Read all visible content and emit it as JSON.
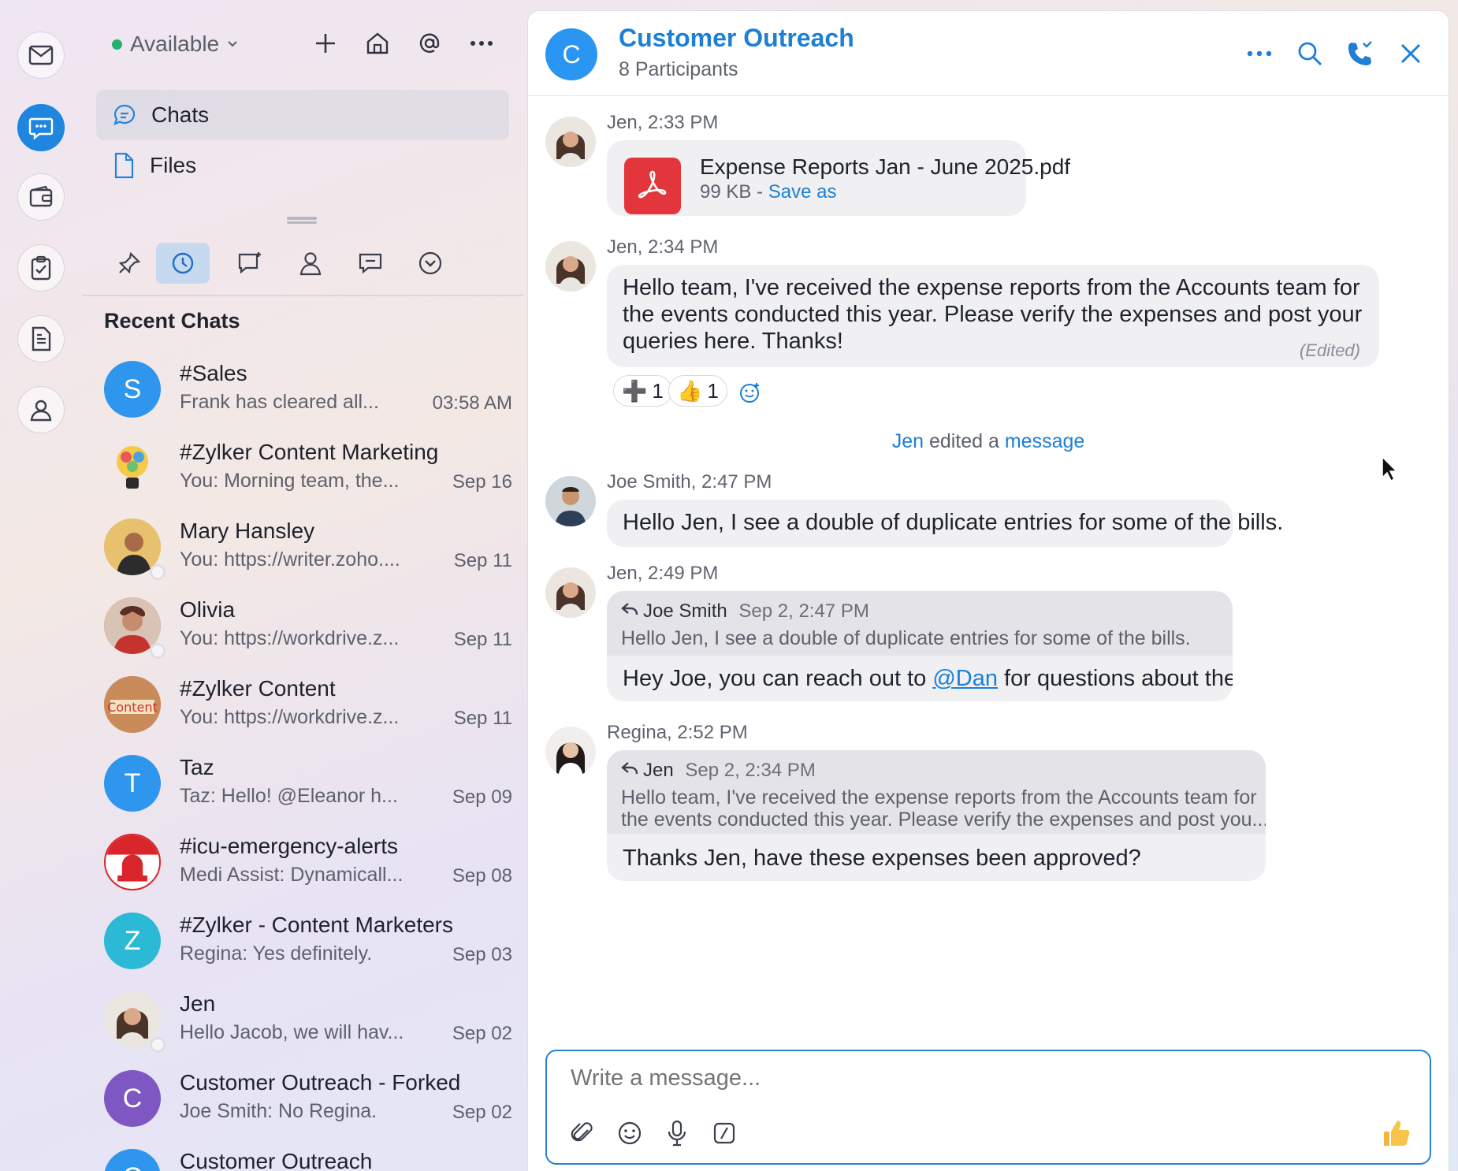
{
  "rail": {
    "items": [
      {
        "name": "mail-icon"
      },
      {
        "name": "chat-icon",
        "active": true
      },
      {
        "name": "wallet-icon"
      },
      {
        "name": "clipboard-icon"
      },
      {
        "name": "document-icon"
      },
      {
        "name": "contacts-icon"
      }
    ]
  },
  "sidebar": {
    "status": "Available",
    "nav": [
      {
        "label": "Chats",
        "icon": "chat-bubble-icon",
        "active": true
      },
      {
        "label": "Files",
        "icon": "file-icon"
      }
    ],
    "filters": [
      "pin-icon",
      "clock-icon",
      "channel-icon",
      "person-icon",
      "thread-icon",
      "chevron-down-circle-icon"
    ],
    "recent_title": "Recent Chats",
    "chats": [
      {
        "name": "#Sales",
        "preview": "Frank has cleared all...",
        "time": "03:58 AM",
        "avatar_letter": "S",
        "avatar_color": "#2f96ee"
      },
      {
        "name": "#Zylker Content Marketing",
        "preview": "You: Morning team, the...",
        "time": "Sep 16",
        "avatar_letter": "",
        "avatar_color": "#ffffff"
      },
      {
        "name": "Mary  Hansley",
        "preview": "You: https://writer.zoho....",
        "time": "Sep 11",
        "avatar_letter": "",
        "avatar_color": "#d99a3a"
      },
      {
        "name": "Olivia",
        "preview": "You: https://workdrive.z...",
        "time": "Sep 11",
        "avatar_letter": "",
        "avatar_color": "#8a4a3b"
      },
      {
        "name": "#Zylker Content",
        "preview": "You: https://workdrive.z...",
        "time": "Sep 11",
        "avatar_letter": "",
        "avatar_color": "#c98b5a"
      },
      {
        "name": "Taz",
        "preview": "Taz: Hello! @Eleanor  h...",
        "time": "Sep 09",
        "avatar_letter": "T",
        "avatar_color": "#2f96ee"
      },
      {
        "name": "#icu-emergency-alerts",
        "preview": "Medi Assist: Dynamicall...",
        "time": "Sep 08",
        "avatar_letter": "",
        "avatar_color": "#d9262c"
      },
      {
        "name": "#Zylker - Content Marketers",
        "preview": "Regina: Yes definitely.",
        "time": "Sep 03",
        "avatar_letter": "Z",
        "avatar_color": "#2cb9d6"
      },
      {
        "name": "Jen",
        "preview": "Hello Jacob, we will hav...",
        "time": "Sep 02",
        "avatar_letter": "",
        "avatar_color": "#b79a87"
      },
      {
        "name": "Customer Outreach - Forked",
        "preview": "Joe Smith: No Regina.",
        "time": "Sep 02",
        "avatar_letter": "C",
        "avatar_color": "#7e57c2"
      },
      {
        "name": "Customer Outreach",
        "preview": "",
        "time": "",
        "avatar_letter": "C",
        "avatar_color": "#2f96ee"
      }
    ]
  },
  "header": {
    "avatar_letter": "C",
    "title": "Customer Outreach",
    "subtitle": "8 Participants"
  },
  "messages": {
    "m1": {
      "author_time": "Jen, 2:33 PM",
      "file_name": "Expense Reports Jan - June 2025.pdf",
      "file_size": "99 KB - ",
      "save_as": "Save as"
    },
    "m2": {
      "author_time": "Jen, 2:34 PM",
      "text": "Hello team, I've received the expense reports from the Accounts team for the events conducted this year. Please verify the expenses and post your queries here. Thanks!",
      "edited": "(Edited)",
      "reactions": [
        {
          "emoji": "➕",
          "count": "1"
        },
        {
          "emoji": "👍",
          "count": "1"
        }
      ]
    },
    "system": {
      "who": "Jen",
      "middle": " edited a ",
      "what": "message"
    },
    "m3": {
      "author_time": "Joe Smith, 2:47 PM",
      "text": "Hello Jen, I see a double of duplicate entries for some of the bills."
    },
    "m4": {
      "author_time": "Jen, 2:49 PM",
      "quote_author": "Joe Smith",
      "quote_time": "Sep 2, 2:47 PM",
      "quote_text": "Hello Jen, I see a double of duplicate entries for some of the bills.",
      "text_before": "Hey Joe, you can reach out to ",
      "mention": "@Dan",
      "text_after": " for questions about the bills."
    },
    "m5": {
      "author_time": "Regina, 2:52 PM",
      "quote_author": "Jen",
      "quote_time": "Sep 2, 2:34 PM",
      "quote_text_1": "Hello team, I've received the expense reports from the Accounts team for",
      "quote_text_2": "the events conducted this year. Please verify the expenses and post you...",
      "text": "Thanks Jen, have these expenses been approved?"
    }
  },
  "composer": {
    "placeholder": "Write a message..."
  },
  "colors": {
    "accent": "#1d7fd6",
    "rail_active": "#1f86e0",
    "pdf_red": "#e2363c"
  }
}
